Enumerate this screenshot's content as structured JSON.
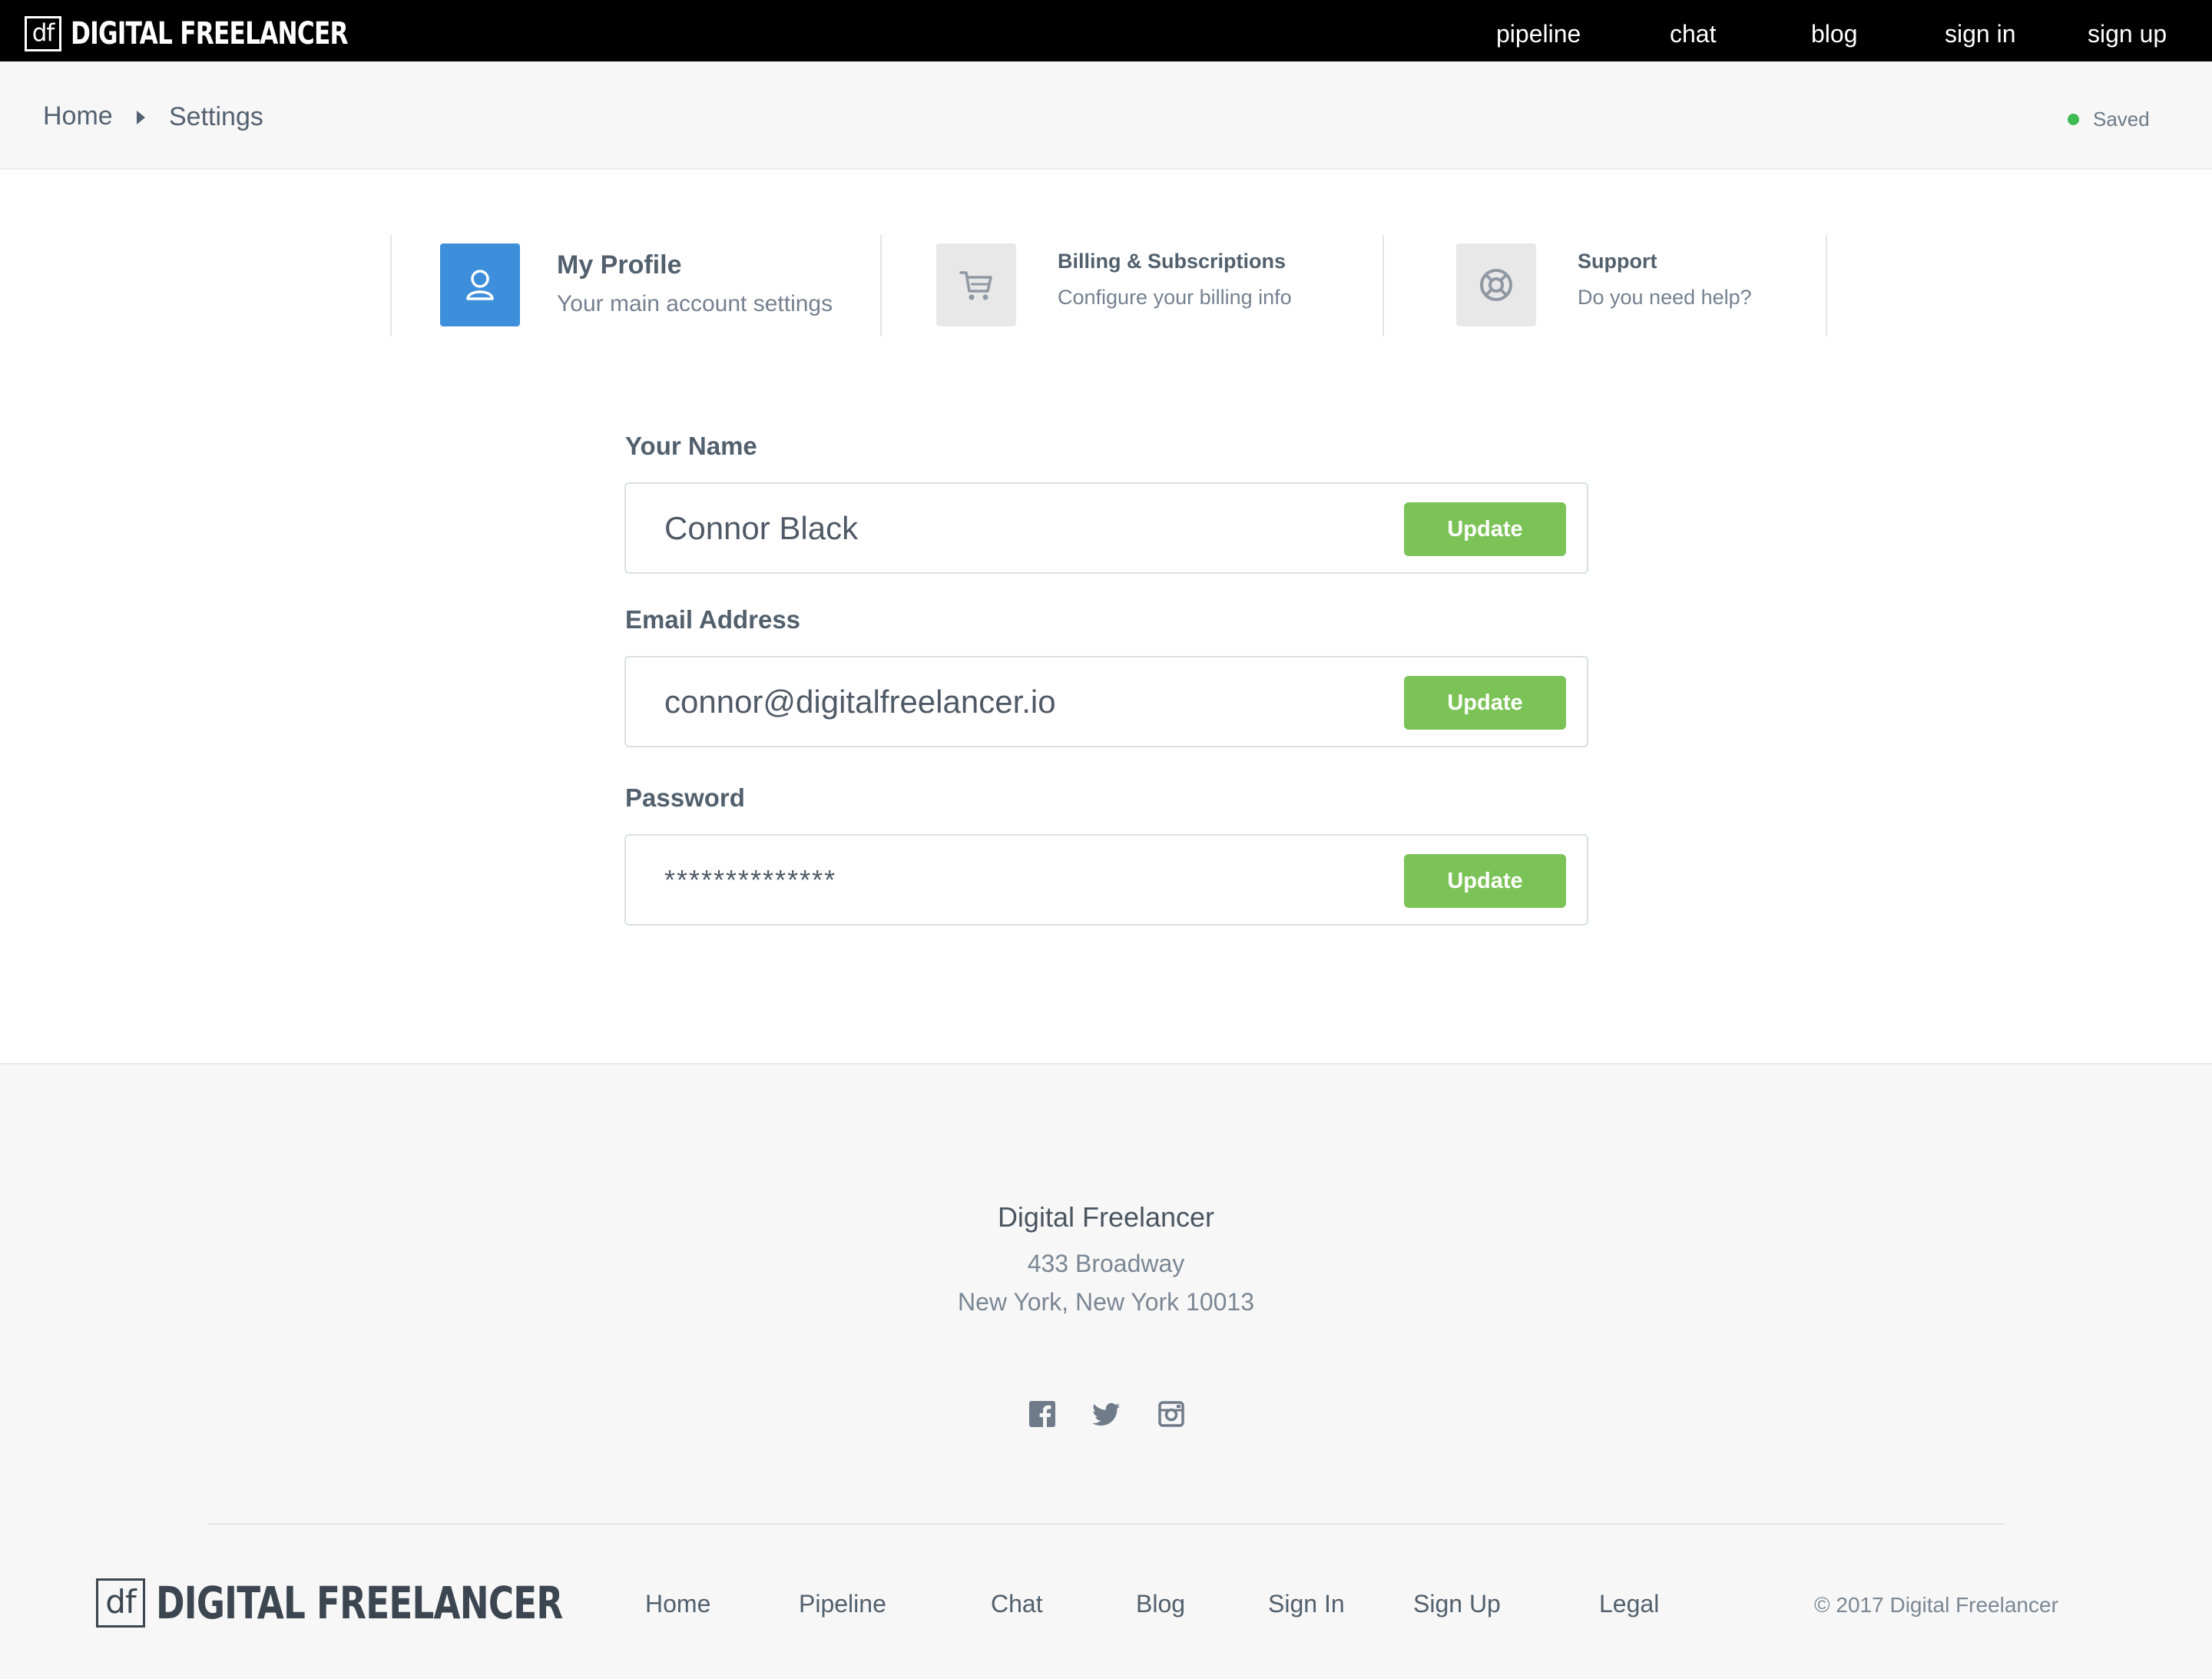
{
  "header": {
    "logo_mark": "df",
    "logo_text": "DIGITAL FREELANCER",
    "nav": [
      "pipeline",
      "chat",
      "blog",
      "sign in",
      "sign up"
    ]
  },
  "breadcrumb": {
    "home": "Home",
    "current": "Settings",
    "status": "Saved",
    "status_color": "#3dbb52"
  },
  "tabs": [
    {
      "icon": "user-icon",
      "title": "My Profile",
      "subtitle": "Your main account settings",
      "active": true
    },
    {
      "icon": "cart-icon",
      "title": "Billing & Subscriptions",
      "subtitle": "Configure your billing info",
      "active": false
    },
    {
      "icon": "lifebuoy-icon",
      "title": "Support",
      "subtitle": "Do you need help?",
      "active": false
    }
  ],
  "form": {
    "name": {
      "label": "Your Name",
      "value": "Connor Black",
      "button": "Update"
    },
    "email": {
      "label": "Email Address",
      "value": "connor@digitalfreelancer.io",
      "button": "Update"
    },
    "password": {
      "label": "Password",
      "value": "**************",
      "button": "Update"
    }
  },
  "footer": {
    "company": "Digital Freelancer",
    "address_line1": "433 Broadway",
    "address_line2": "New York, New York 10013",
    "social": [
      "facebook-icon",
      "twitter-icon",
      "instagram-icon"
    ],
    "logo_mark": "df",
    "logo_text": "DIGITAL FREELANCER",
    "links": [
      "Home",
      "Pipeline",
      "Chat",
      "Blog",
      "Sign In",
      "Sign Up",
      "Legal"
    ],
    "copyright": "© 2017 Digital Freelancer"
  },
  "colors": {
    "accent": "#3d8edb",
    "button_green": "#7cc357",
    "topbar": "#000000"
  }
}
